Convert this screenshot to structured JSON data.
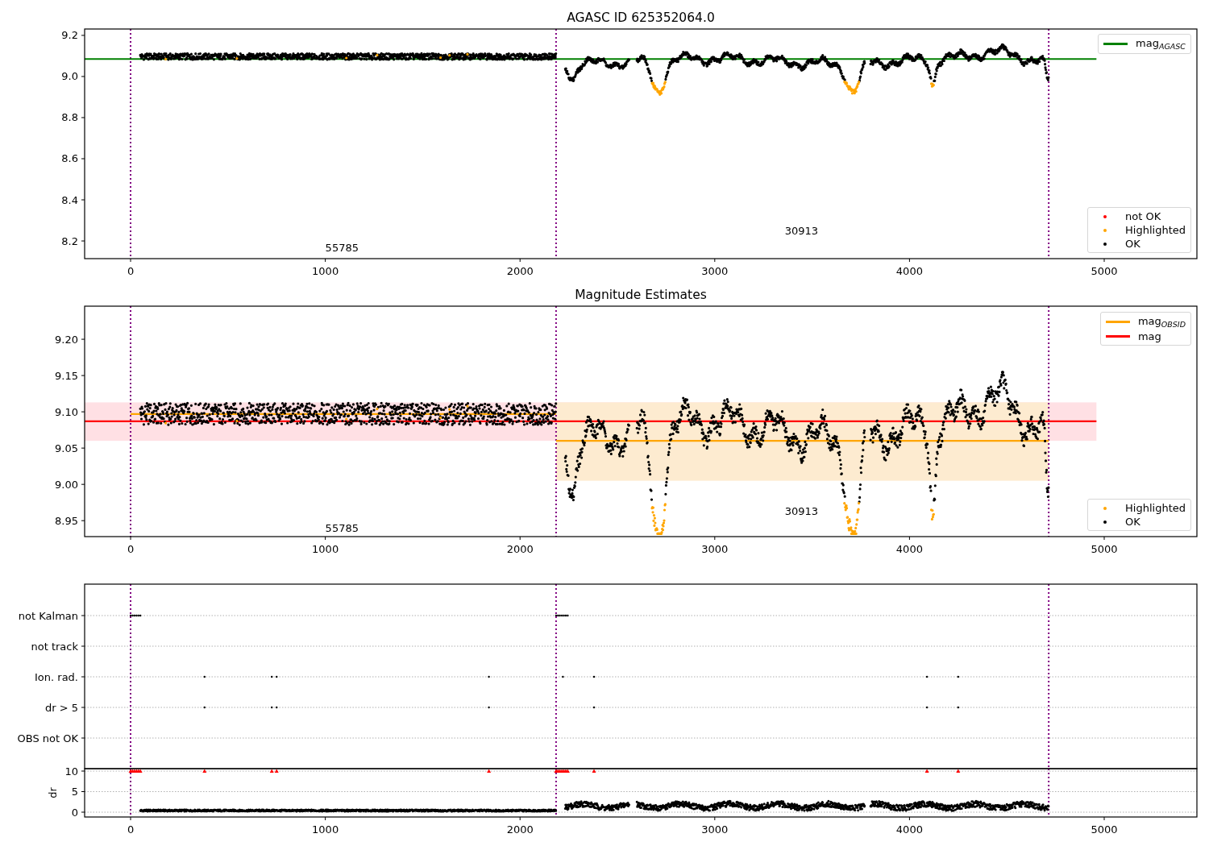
{
  "figure": {
    "panels": [
      {
        "kind": "magnitude",
        "title": "AGASC ID 625352064.0",
        "y_tick_labels": [
          "9.2",
          "9.0",
          "8.8",
          "8.6",
          "8.4",
          "8.2"
        ],
        "x_tick_labels": [
          "0",
          "1000",
          "2000",
          "3000",
          "4000",
          "5000"
        ],
        "legend_upper": [
          {
            "label": "mag$_{AGASC}$",
            "color": "#008000"
          }
        ],
        "legend_lower": [
          {
            "label": "not OK",
            "color": "#ff0000"
          },
          {
            "label": "Highlighted",
            "color": "#ffa500"
          },
          {
            "label": "OK",
            "color": "#000000"
          }
        ],
        "obsid_labels": [
          "55785",
          "30913"
        ]
      },
      {
        "kind": "magnitude",
        "title": "Magnitude Estimates",
        "y_tick_labels": [
          "9.20",
          "9.15",
          "9.10",
          "9.05",
          "9.00",
          "8.95"
        ],
        "x_tick_labels": [
          "0",
          "1000",
          "2000",
          "3000",
          "4000",
          "5000"
        ],
        "legend_upper": [
          {
            "label": "mag$_{OBSID}$",
            "color": "#ffa500"
          },
          {
            "label": "mag",
            "color": "#ff0000"
          }
        ],
        "legend_lower": [
          {
            "label": "Highlighted",
            "color": "#ffa500"
          },
          {
            "label": "OK",
            "color": "#000000"
          }
        ],
        "obsid_labels": [
          "55785",
          "30913"
        ]
      },
      {
        "kind": "flags",
        "flag_labels": [
          "not Kalman",
          "not track",
          "Ion. rad.",
          "dr > 5",
          "OBS not OK"
        ],
        "dr_axis": {
          "label": "dr",
          "y_tick_labels": [
            "10",
            "5",
            "0"
          ]
        },
        "x_tick_labels": [
          "0",
          "1000",
          "2000",
          "3000",
          "4000",
          "5000"
        ]
      }
    ]
  }
}
